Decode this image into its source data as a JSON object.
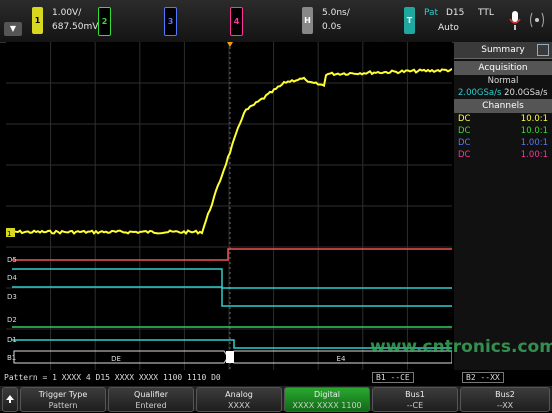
{
  "header": {
    "ch1_scale": "1.00V/",
    "ch1_offset": "687.50mV",
    "ch1_num": "1",
    "ch2_num": "2",
    "ch3_num": "3",
    "ch4_num": "4",
    "h_label": "H",
    "time_scale": "5.0ns/",
    "time_delay": "0.0s",
    "t_label": "T",
    "trig_type": "Pat",
    "trig_src": "D15",
    "trig_level": "TTL",
    "trig_mode": "Auto",
    "menu_glyph": "▼"
  },
  "summary": {
    "title": "Summary",
    "acq_header": "Acquisition",
    "acq_mode": "Normal",
    "rate1": "2.00GSa/s",
    "rate2": "20.0GSa/s",
    "channels_header": "Channels",
    "channels": [
      {
        "coupling": "DC",
        "ratio": "10.0:1",
        "color": "#ffff33"
      },
      {
        "coupling": "DC",
        "ratio": "10.0:1",
        "color": "#33dd33"
      },
      {
        "coupling": "DC",
        "ratio": "1.00:1",
        "color": "#5577ff"
      },
      {
        "coupling": "DC",
        "ratio": "1.00:1",
        "color": "#ff3399"
      }
    ]
  },
  "waveform": {
    "marker_1": "1",
    "digital_labels": [
      "D5",
      "D4",
      "D3",
      "D2",
      "D1",
      "B1"
    ],
    "bus_left": "DE",
    "bus_right": "E4"
  },
  "pattern": {
    "text": "Pattern = 1 XXXX 4 D15 XXXX XXXX 1100 1110 D0",
    "b1": "B1 --CE",
    "b2": "B2 --XX"
  },
  "softkeys": [
    {
      "label": "Trigger Type",
      "value": "Pattern"
    },
    {
      "label": "Qualifier",
      "value": "Entered"
    },
    {
      "label": "Analog",
      "value": "XXXX"
    },
    {
      "label": "Digital",
      "value": "XXXX XXXX 1100"
    },
    {
      "label": "Bus1",
      "value": "--CE"
    },
    {
      "label": "Bus2",
      "value": "--XX"
    }
  ],
  "watermark": "www.cntronics.com",
  "colors": {
    "ch1": "#ffff33",
    "ch2": "#33dd33",
    "ch3": "#5577ff",
    "ch4": "#ff3399",
    "trace_cyan": "#33cccc",
    "trace_green": "#33cc66",
    "trace_red": "#ee5555"
  }
}
